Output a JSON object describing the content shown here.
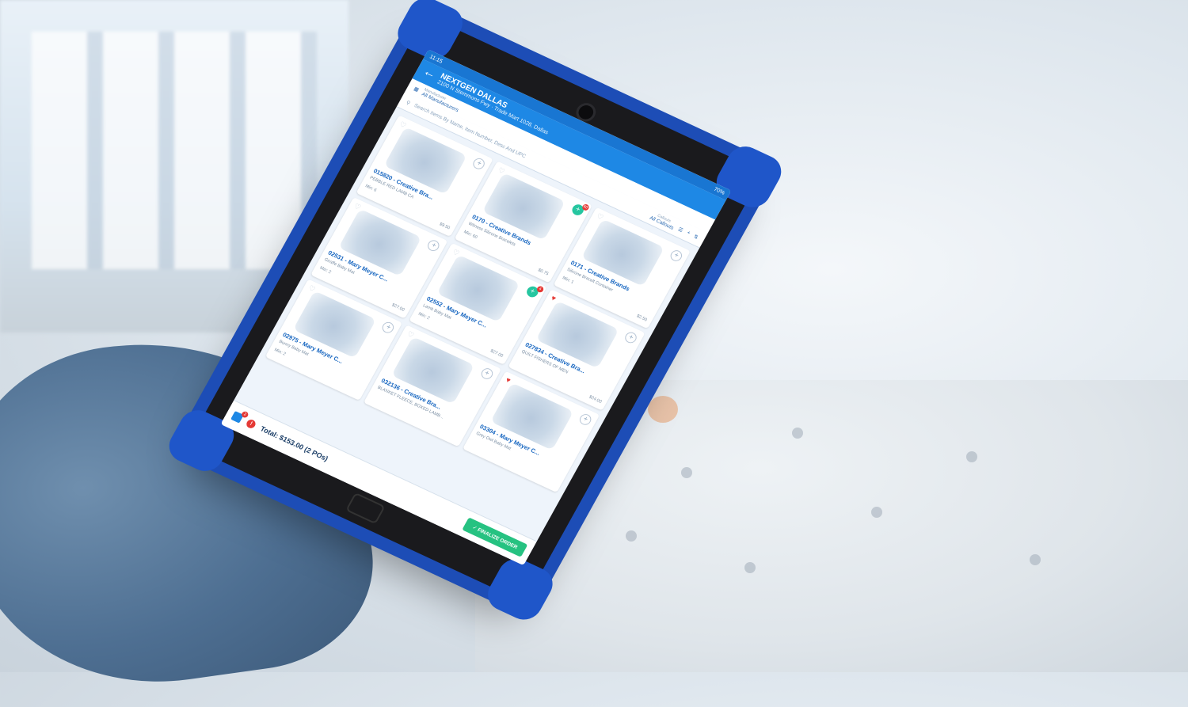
{
  "header": {
    "time": "11:15",
    "battery": "70%",
    "store_name": "NEXTGEN DALLAS",
    "address": "2100 N Stemmons Fwy · Trade Mart 1028, Dallas"
  },
  "filters": {
    "manufacturer_label": "Manufacturer",
    "manufacturer_value": "All Manufacturers",
    "search_placeholder": "Search Items By Name, Item Number, Desc And UPC",
    "callouts_label": "Callouts",
    "callouts_value": "All Callouts"
  },
  "products": [
    {
      "title": "015820 - Creative Bra...",
      "desc": "PEBBLE RED LAMB CA",
      "min": "Min: 6",
      "price": "$9.50",
      "added": false,
      "favorite": false,
      "badge": ""
    },
    {
      "title": "0170 - Creative Brands",
      "desc": "Witness Silicone Bracelets",
      "min": "Min: 60",
      "price": "$0.75",
      "added": true,
      "favorite": false,
      "badge": "60"
    },
    {
      "title": "0171 - Creative Brands",
      "desc": "Silicone Bracelt Container",
      "min": "Min: 1",
      "price": "$2.50",
      "added": false,
      "favorite": false,
      "badge": ""
    },
    {
      "title": "02531 - Mary Meyer C...",
      "desc": "Giraffe Baby Mat",
      "min": "Min: 2",
      "price": "$27.00",
      "added": false,
      "favorite": false,
      "badge": ""
    },
    {
      "title": "02552 - Mary Meyer C...",
      "desc": "Lamb Baby Mat",
      "min": "Min: 2",
      "price": "$27.00",
      "added": true,
      "favorite": false,
      "badge": "4"
    },
    {
      "title": "027834 - Creative Bra...",
      "desc": "QUILT FISHERS OF MEN",
      "min": "",
      "price": "$24.00",
      "added": false,
      "favorite": true,
      "badge": ""
    },
    {
      "title": "02975 - Mary Meyer C...",
      "desc": "Bunny Baby Mat",
      "min": "Min: 2",
      "price": "",
      "added": false,
      "favorite": false,
      "badge": ""
    },
    {
      "title": "032136 - Creative Bra...",
      "desc": "BLANKET FLEECE, BOXED LAMB...",
      "min": "",
      "price": "",
      "added": false,
      "favorite": false,
      "badge": ""
    },
    {
      "title": "03304 - Mary Meyer C...",
      "desc": "Grey Owl Baby Mat",
      "min": "",
      "price": "",
      "added": false,
      "favorite": true,
      "badge": ""
    }
  ],
  "footer": {
    "total": "Total: $153.00 (2 POs)",
    "finalize_label": "✓ FINALIZE ORDER"
  },
  "icons": {
    "back": "back-arrow-icon",
    "search": "search-icon",
    "menu": "hamburger-menu-icon",
    "add": "plus-icon",
    "sort": "sort-icon",
    "cart": "cart-icon",
    "alert": "alert-icon",
    "heart": "heart-icon"
  },
  "colors": {
    "app_bar": "#1e88e5",
    "accent_green": "#26c281",
    "case_blue": "#1d4db6",
    "favorite_red": "#e53935"
  }
}
